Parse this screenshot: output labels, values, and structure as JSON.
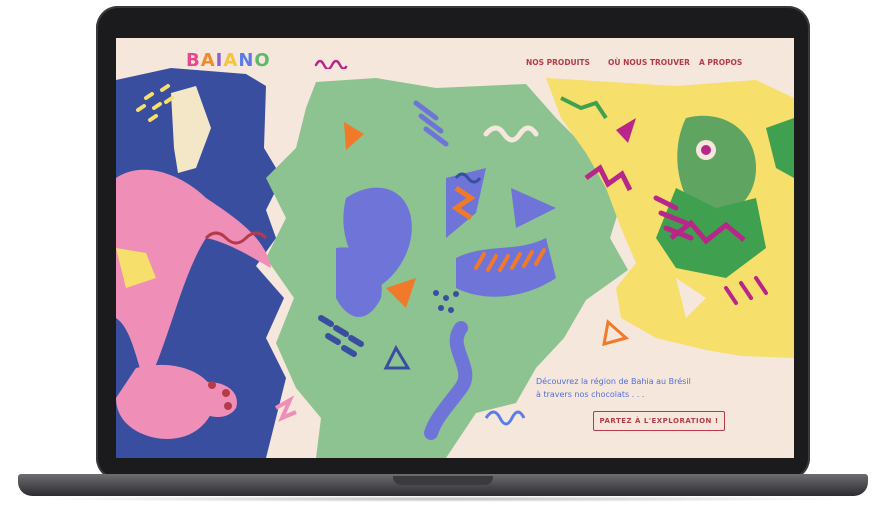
{
  "brand": {
    "logo_letters": [
      "B",
      "A",
      "I",
      "A",
      "N",
      "O"
    ],
    "logo_colors": [
      "#e8478b",
      "#f08a2a",
      "#8a5fd0",
      "#f5c53a",
      "#5b7ce8",
      "#5fb86a"
    ]
  },
  "nav": {
    "items": [
      {
        "label": "NOS PRODUITS"
      },
      {
        "label": "OÙ NOUS TROUVER"
      },
      {
        "label": "A PROPOS"
      }
    ]
  },
  "hero": {
    "tagline_line1": "Découvrez la région de Bahia au Brésil",
    "tagline_line2": "à travers nos chocolats . . .",
    "cta_label": "PARTEZ À L'EXPLORATION !"
  },
  "colors": {
    "background": "#f6e7dc",
    "blue": "#3a4ea0",
    "green": "#8cc391",
    "yellow": "#f6df6a",
    "pink": "#ef8fb8",
    "purple": "#6f74d8",
    "orange": "#f07a2a",
    "accent_red": "#b43c4a",
    "magenta": "#b8268a"
  },
  "icons": {
    "logo_squiggle": "squiggle-icon"
  }
}
